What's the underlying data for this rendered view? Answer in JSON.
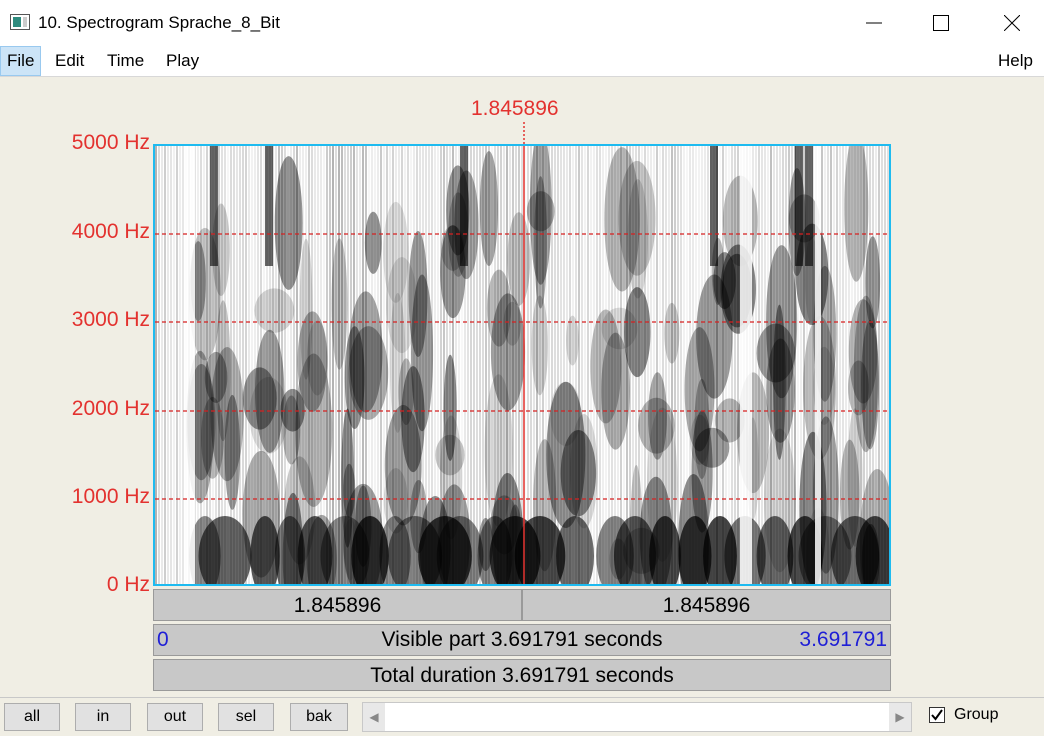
{
  "window": {
    "title": "10. Spectrogram Sprache_8_Bit",
    "icons": [
      "app-icon",
      "minimize-icon",
      "maximize-icon",
      "close-icon"
    ]
  },
  "menu": {
    "items": [
      "File",
      "Edit",
      "Time",
      "Play"
    ],
    "help": "Help"
  },
  "spectrogram": {
    "cursor_time": "1.845896",
    "freq_labels": [
      "5000 Hz",
      "4000 Hz",
      "3000 Hz",
      "2000 Hz",
      "1000 Hz",
      "0 Hz"
    ],
    "left_segment": "1.845896",
    "right_segment": "1.845896",
    "visible_start": "0",
    "visible_text": "Visible part 3.691791 seconds",
    "visible_end": "3.691791",
    "total_text": "Total duration 3.691791 seconds",
    "colors": {
      "cursor": "#e3322f",
      "border": "#1ebbf0",
      "blue_text": "#1f1fd6"
    }
  },
  "bottom": {
    "buttons": [
      "all",
      "in",
      "out",
      "sel",
      "bak"
    ],
    "group_label": "Group",
    "group_checked": true
  }
}
